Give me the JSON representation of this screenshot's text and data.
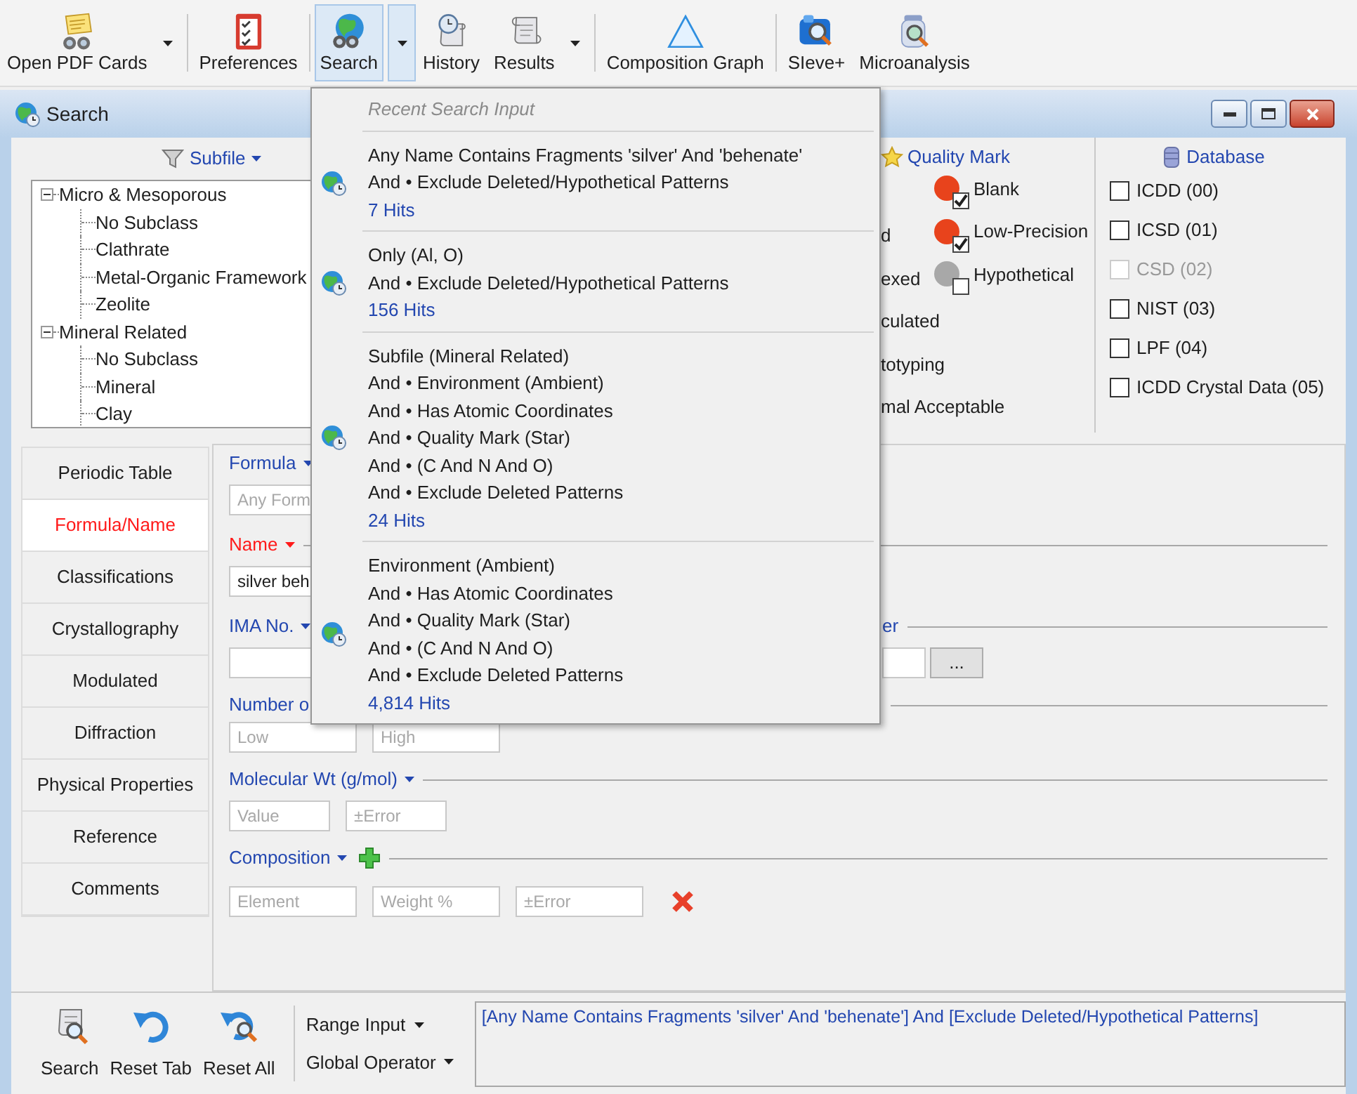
{
  "toolbar": [
    [
      {
        "label": "Open PDF Cards",
        "has_menu": true,
        "selected": false
      }
    ],
    [
      {
        "label": "Preferences",
        "has_menu": false,
        "selected": false
      }
    ],
    [
      {
        "label": "Search",
        "has_menu": true,
        "selected": true
      },
      {
        "label": "History",
        "has_menu": false,
        "selected": false
      },
      {
        "label": "Results",
        "has_menu": true,
        "selected": false
      }
    ],
    [
      {
        "label": "Composition Graph",
        "has_menu": false,
        "selected": false
      }
    ],
    [
      {
        "label": "SIeve+",
        "has_menu": false,
        "selected": false
      },
      {
        "label": "Microanalysis",
        "has_menu": false,
        "selected": false
      }
    ]
  ],
  "window": {
    "title": "Search"
  },
  "subfile": {
    "label": "Subfile",
    "tree": [
      {
        "label": "Micro & Mesoporous",
        "expanded": true,
        "children": [
          {
            "label": "No Subclass"
          },
          {
            "label": "Clathrate"
          },
          {
            "label": "Metal-Organic Framework"
          },
          {
            "label": "Zeolite"
          }
        ]
      },
      {
        "label": "Mineral Related",
        "expanded": true,
        "children": [
          {
            "label": "No Subclass"
          },
          {
            "label": "Mineral"
          },
          {
            "label": "Clay"
          }
        ]
      }
    ]
  },
  "quality_mark": {
    "label": "Quality Mark",
    "column_1": [
      "d",
      "exed",
      "culated",
      "totyping",
      "mal Acceptable"
    ],
    "options": [
      {
        "label": "Blank",
        "checked": true,
        "color": "#e8431c"
      },
      {
        "label": "Low-Precision",
        "checked": true,
        "color": "#e8431c"
      },
      {
        "label": "Hypothetical",
        "checked": false,
        "color": "#a8a8a8"
      }
    ]
  },
  "database": {
    "label": "Database",
    "options": [
      {
        "label": "ICDD (00)",
        "checked": false,
        "disabled": false
      },
      {
        "label": "ICSD (01)",
        "checked": false,
        "disabled": false
      },
      {
        "label": "CSD (02)",
        "checked": false,
        "disabled": true
      },
      {
        "label": "NIST (03)",
        "checked": false,
        "disabled": false
      },
      {
        "label": "LPF (04)",
        "checked": false,
        "disabled": false
      },
      {
        "label": "ICDD Crystal Data (05)",
        "checked": false,
        "disabled": false
      }
    ]
  },
  "tabs": [
    {
      "label": "Periodic Table",
      "selected": false
    },
    {
      "label": "Formula/Name",
      "selected": true
    },
    {
      "label": "Classifications",
      "selected": false
    },
    {
      "label": "Crystallography",
      "selected": false
    },
    {
      "label": "Modulated",
      "selected": false
    },
    {
      "label": "Diffraction",
      "selected": false
    },
    {
      "label": "Physical Properties",
      "selected": false
    },
    {
      "label": "Reference",
      "selected": false
    },
    {
      "label": "Comments",
      "selected": false
    }
  ],
  "form": {
    "formula": {
      "label": "Formula",
      "active": false,
      "placeholder": "Any Form"
    },
    "name": {
      "label": "Name",
      "active": true,
      "value": "silver beh"
    },
    "ima": {
      "label": "IMA No.",
      "active": false,
      "column_2": "er",
      "button": "..."
    },
    "number": {
      "label": "Number o",
      "active": false,
      "placeholders": [
        "Low",
        "High"
      ]
    },
    "molecular_wt": {
      "label": "Molecular Wt (g/mol)",
      "active": false,
      "placeholders": [
        "Value",
        "±Error"
      ]
    },
    "composition": {
      "label": "Composition",
      "active": false,
      "placeholders": [
        "Element",
        "Weight %",
        "±Error"
      ]
    }
  },
  "bottom": {
    "actions": [
      {
        "label": "Search"
      },
      {
        "label": "Reset Tab"
      },
      {
        "label": "Reset All"
      }
    ],
    "menus": [
      "Range Input",
      "Global Operator"
    ],
    "query": "[Any Name Contains Fragments 'silver' And 'behenate'] And [Exclude Deleted/Hypothetical Patterns]"
  },
  "recent_searches": {
    "title": "Recent Search Input",
    "items": [
      {
        "lines": [
          "Any Name Contains Fragments 'silver' And 'behenate'",
          "And • Exclude Deleted/Hypothetical Patterns"
        ],
        "hits": "7 Hits"
      },
      {
        "lines": [
          "Only (Al, O)",
          "And • Exclude Deleted/Hypothetical Patterns"
        ],
        "hits": "156 Hits"
      },
      {
        "lines": [
          "Subfile (Mineral Related)",
          "And • Environment (Ambient)",
          "And • Has Atomic Coordinates",
          "And • Quality Mark (Star)",
          "And • (C And N And O)",
          "And • Exclude Deleted Patterns"
        ],
        "hits": "24 Hits"
      },
      {
        "lines": [
          "Environment (Ambient)",
          "And • Has Atomic Coordinates",
          "And • Quality Mark (Star)",
          "And • (C And N And O)",
          "And • Exclude Deleted Patterns"
        ],
        "hits": "4,814 Hits"
      }
    ]
  }
}
